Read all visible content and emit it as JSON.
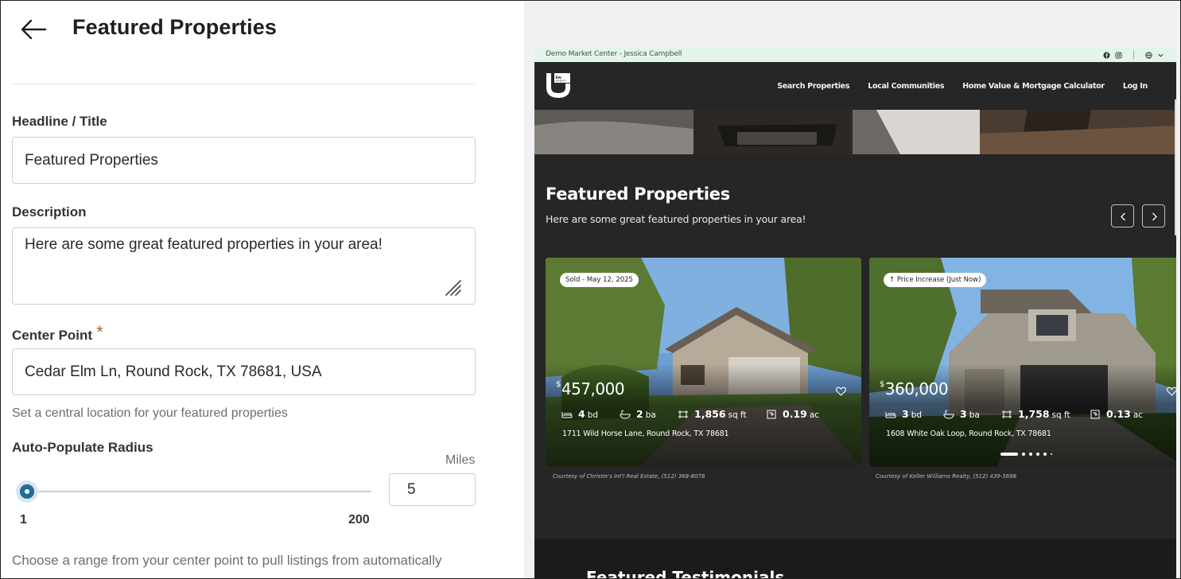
{
  "editor": {
    "title": "Featured Properties",
    "headline_label": "Headline / Title",
    "headline_value": "Featured Properties",
    "description_label": "Description",
    "description_value": "Here are some great featured properties in your area!",
    "center_point_label": "Center Point",
    "center_point_required": "*",
    "center_point_value": "Cedar Elm Ln, Round Rock, TX 78681, USA",
    "center_point_help": "Set a central location for your featured properties",
    "radius_label": "Auto-Populate Radius",
    "radius_unit": "Miles",
    "radius_min": "1",
    "radius_max": "200",
    "radius_value": "5",
    "radius_help": "Choose a range from your center point to pull listings from automatically"
  },
  "preview": {
    "topbar_text": "Demo Market Center - Jessica Campbell",
    "nav": [
      "Search Properties",
      "Local Communities",
      "Home Value & Mortgage Calculator",
      "Log In"
    ],
    "section_title": "Featured Properties",
    "section_description": "Here are some great featured properties in your area!",
    "cards": [
      {
        "badge": "Sold - May 12, 2025",
        "currency": "$",
        "price": "457,000",
        "beds": "4",
        "beds_unit": "bd",
        "baths": "2",
        "baths_unit": "ba",
        "sqft": "1,856",
        "sqft_unit": "sq ft",
        "acres": "0.19",
        "acres_unit": "ac",
        "address": "1711 Wild Horse Lane, Round Rock, TX 78681",
        "courtesy": "Courtesy of Christie's Int'l Real Estate, (512) 368-8078"
      },
      {
        "badge": "Price Increase (Just Now)",
        "currency": "$",
        "price": "360,000",
        "beds": "3",
        "beds_unit": "bd",
        "baths": "3",
        "baths_unit": "ba",
        "sqft": "1,758",
        "sqft_unit": "sq ft",
        "acres": "0.13",
        "acres_unit": "ac",
        "address": "1608 White Oak Loop, Round Rock, TX 78681",
        "courtesy": "Courtesy of Keller Williams Realty, (512) 439-3698"
      }
    ],
    "next_section_title": "Featured Testimonials"
  },
  "colors": {
    "accent": "#1f6e97",
    "required": "#b5651d",
    "preview_bg": "#262626",
    "topbar_bg": "#e3f5ea"
  },
  "icons": [
    "back-arrow-icon",
    "resize-grip-icon",
    "facebook-icon",
    "instagram-icon",
    "globe-icon",
    "chevron-down-icon",
    "chevron-left-icon",
    "chevron-right-icon",
    "heart-icon",
    "bed-icon",
    "bath-icon",
    "sqft-icon",
    "lot-icon"
  ]
}
